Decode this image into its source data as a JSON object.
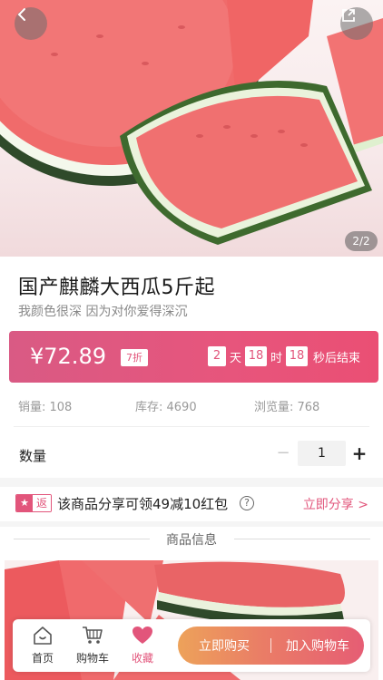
{
  "hero": {
    "page_indicator": "2/2",
    "back_icon": "chevron-left-icon",
    "share_icon": "share-out-icon"
  },
  "product": {
    "title": "国产麒麟大西瓜5斤起",
    "subtitle": "我颜色很深 因为对你爱得深沉"
  },
  "price_bar": {
    "price": "¥72.89",
    "discount": "7折",
    "countdown": {
      "days": "2",
      "days_unit": "天",
      "hours": "18",
      "hours_unit": "时",
      "minutes": "18",
      "tail": "秒后结束"
    }
  },
  "stats": {
    "sales": "销量: 108",
    "stock": "库存: 4690",
    "views": "浏览量: 768"
  },
  "quantity": {
    "label": "数量",
    "minus": "−",
    "value": "1",
    "plus": "+"
  },
  "share_promo": {
    "badge_icon": "star-icon",
    "badge_text": "返",
    "text": "该商品分享可领49减10红包",
    "help": "?",
    "link": "立即分享 >"
  },
  "section": {
    "title": "商品信息"
  },
  "bottom_bar": {
    "home": "首页",
    "cart": "购物车",
    "favorite": "收藏",
    "buy_now": "立即购买",
    "add_cart": "加入购物车"
  },
  "colors": {
    "accent": "#e2557b",
    "price_bar_start": "#d95a84",
    "price_bar_end": "#ea4f74",
    "button_start": "#eda25a",
    "button_end": "#e65d74"
  }
}
